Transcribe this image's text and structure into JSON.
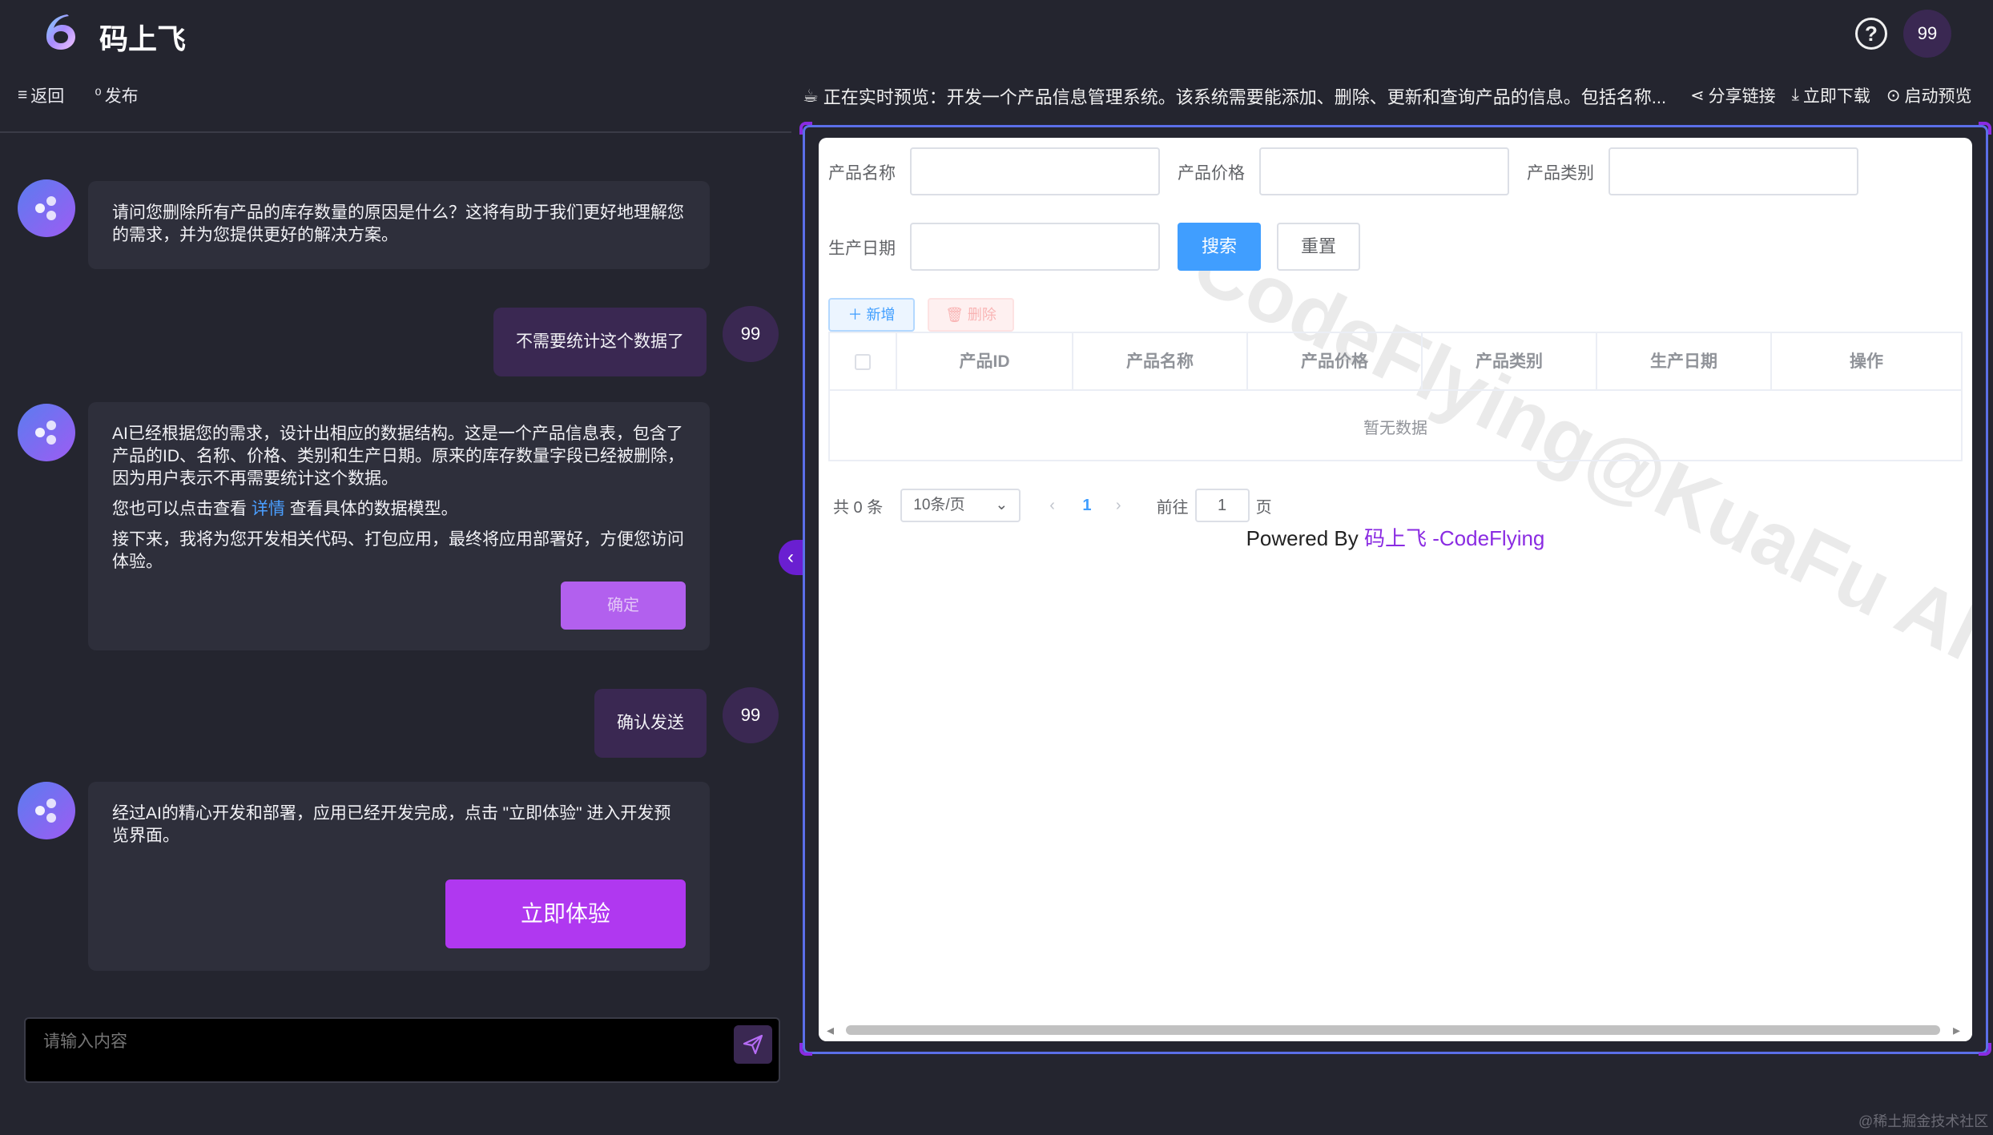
{
  "header": {
    "app_name": "码上飞",
    "user_avatar": "99",
    "help_icon": "help-circle-icon"
  },
  "toolbar": {
    "back_label": "返回",
    "publish_label": "发布",
    "preview_title": "正在实时预览：开发一个产品信息管理系统。该系统需要能添加、删除、更新和查询产品的信息。包括名称...",
    "share_label": "分享链接",
    "download_label": "立即下载",
    "launch_label": "启动预览"
  },
  "chat": {
    "messages": [
      {
        "role": "ai",
        "text": "请问您删除所有产品的库存数量的原因是什么？这将有助于我们更好地理解您的需求，并为您提供更好的解决方案。"
      },
      {
        "role": "user",
        "avatar": "99",
        "text": "不需要统计这个数据了"
      },
      {
        "role": "ai",
        "p1": "AI已经根据您的需求，设计出相应的数据结构。这是一个产品信息表，包含了产品的ID、名称、价格、类别和生产日期。原来的库存数量字段已经被删除，因为用户表示不再需要统计这个数据。",
        "p2_before": "您也可以点击查看",
        "p2_link": "详情",
        "p2_after": "查看具体的数据模型。",
        "p3": "接下来，我将为您开发相关代码、打包应用，最终将应用部署好，方便您访问体验。",
        "button": "确定"
      },
      {
        "role": "user",
        "avatar": "99",
        "text": "确认发送"
      },
      {
        "role": "ai",
        "text": "经过AI的精心开发和部署，应用已经开发完成，点击 \"立即体验\" 进入开发预览界面。",
        "button": "立即体验"
      }
    ],
    "input_placeholder": "请输入内容"
  },
  "preview": {
    "form": {
      "name_label": "产品名称",
      "price_label": "产品价格",
      "category_label": "产品类别",
      "date_label": "生产日期",
      "search_button": "搜索",
      "reset_button": "重置"
    },
    "add_button": "新增",
    "delete_button": "删除",
    "table": {
      "columns": [
        "产品ID",
        "产品名称",
        "产品价格",
        "产品类别",
        "生产日期",
        "操作"
      ],
      "empty_text": "暂无数据"
    },
    "pagination": {
      "total": "共 0 条",
      "page_size": "10条/页",
      "current_page": "1",
      "goto_label": "前往",
      "goto_value": "1",
      "page_unit": "页"
    },
    "powered_prefix": "Powered By ",
    "powered_brand": "码上飞 -CodeFlying",
    "watermark": "CodeFlying@KuaFu AI"
  },
  "footer_watermark": "@稀土掘金技术社区",
  "colors": {
    "background": "#24252f",
    "accent_purple": "#b038f0",
    "primary_blue": "#409eff",
    "frame_blue": "#5b6fe8"
  }
}
